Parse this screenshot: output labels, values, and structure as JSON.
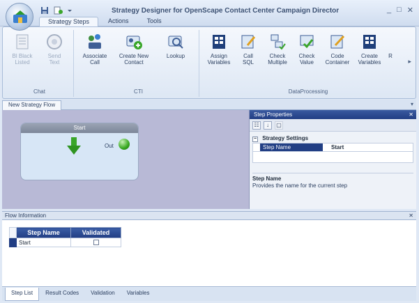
{
  "window": {
    "title": "Strategy Designer for OpenScape Contact Center Campaign Director",
    "controls": [
      "_",
      "□",
      "✕"
    ]
  },
  "ribbon": {
    "tabs": [
      {
        "label": "Strategy Steps",
        "active": true
      },
      {
        "label": "Actions",
        "active": false
      },
      {
        "label": "Tools",
        "active": false
      }
    ],
    "groups": {
      "chat": {
        "label": "Chat",
        "buttons": [
          {
            "label_1": "Bl Black",
            "label_2": "Listed",
            "icon": "blacklist-icon",
            "disabled": true
          },
          {
            "label_1": "Send",
            "label_2": "Text",
            "icon": "send-text-icon",
            "disabled": true
          }
        ]
      },
      "cti": {
        "label": "CTI",
        "buttons": [
          {
            "label_1": "Associate",
            "label_2": "Call",
            "icon": "associate-call-icon"
          },
          {
            "label_1": "Create New",
            "label_2": "Contact",
            "icon": "create-contact-icon"
          },
          {
            "label_1": "Lookup",
            "label_2": "",
            "icon": "lookup-icon"
          }
        ]
      },
      "dataprocessing": {
        "label": "DataProcessing",
        "buttons": [
          {
            "label_1": "Assign",
            "label_2": "Variables",
            "icon": "assign-variables-icon"
          },
          {
            "label_1": "Call",
            "label_2": "SQL",
            "icon": "call-sql-icon"
          },
          {
            "label_1": "Check",
            "label_2": "Multiple",
            "icon": "check-multiple-icon"
          },
          {
            "label_1": "Check",
            "label_2": "Value",
            "icon": "check-value-icon"
          },
          {
            "label_1": "Code",
            "label_2": "Container",
            "icon": "code-container-icon"
          },
          {
            "label_1": "Create",
            "label_2": "Variables",
            "icon": "create-variables-icon"
          },
          {
            "label_1": "R",
            "label_2": "",
            "icon": "more-icon"
          }
        ]
      }
    }
  },
  "document": {
    "tab": "New Strategy Flow",
    "pin": "▾"
  },
  "canvas": {
    "step": {
      "title": "Start",
      "out_label": "Out"
    }
  },
  "properties": {
    "title": "Step Properties",
    "pin": "✕",
    "toolbar": [
      "☷",
      "↓",
      "▢"
    ],
    "category": "Strategy Settings",
    "category_toggle": "−",
    "row": {
      "key": "Step Name",
      "value": "Start"
    },
    "description_title": "Step Name",
    "description": "Provides the name for the current step"
  },
  "flow_info": {
    "title": "Flow Information",
    "pin": "✕",
    "columns": [
      "Step Name",
      "Validated"
    ],
    "rows": [
      {
        "name": "Start",
        "validated": false
      }
    ]
  },
  "bottom_tabs": [
    {
      "label": "Step List",
      "active": true
    },
    {
      "label": "Result Codes",
      "active": false
    },
    {
      "label": "Validation",
      "active": false
    },
    {
      "label": "Variables",
      "active": false
    }
  ]
}
